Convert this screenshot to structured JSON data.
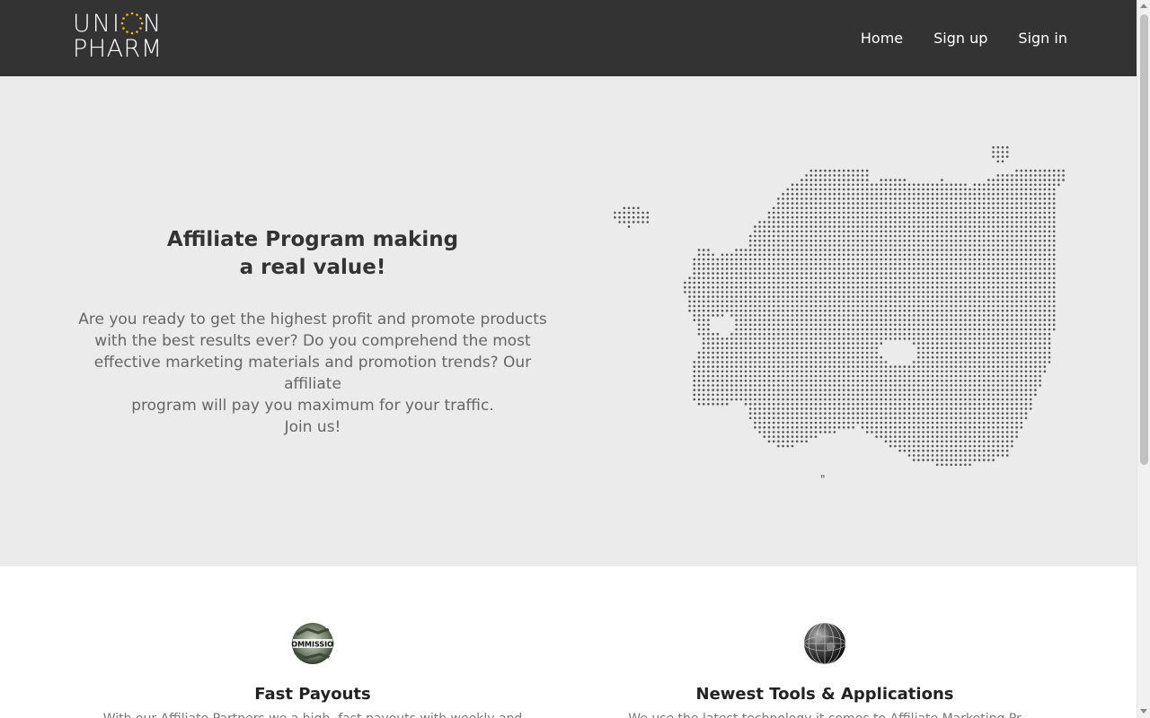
{
  "brand": {
    "line1_left": "UNI",
    "line1_right": "N",
    "line2": "PHARM",
    "star_color": "#f2c200"
  },
  "nav": {
    "items": [
      {
        "label": "Home"
      },
      {
        "label": "Sign up"
      },
      {
        "label": "Sign in"
      }
    ]
  },
  "hero": {
    "title_line1": "Affiliate Program making",
    "title_line2": "a real value!",
    "text_line1": "Are you ready to get the highest profit and promote products",
    "text_line2": "with the best results ever? Do you comprehend the most",
    "text_line3": "effective marketing materials and promotion trends? Our affiliate",
    "text_line4": "program will pay you maximum for your traffic.",
    "text_line5": "Join us!",
    "map_mark": "\""
  },
  "features": [
    {
      "icon": "commission-icon",
      "icon_text": "COMMISSION",
      "title": "Fast Payouts",
      "desc": "With our Affiliate Partners we a high, fast payouts with weekly and"
    },
    {
      "icon": "globe-icon",
      "title": "Newest Tools & Applications",
      "desc": "We use the latest technology it comes to Affiliate Marketing Pr"
    }
  ],
  "colors": {
    "header_bg": "#333333",
    "hero_bg": "#ebebeb",
    "dot": "#555555"
  }
}
